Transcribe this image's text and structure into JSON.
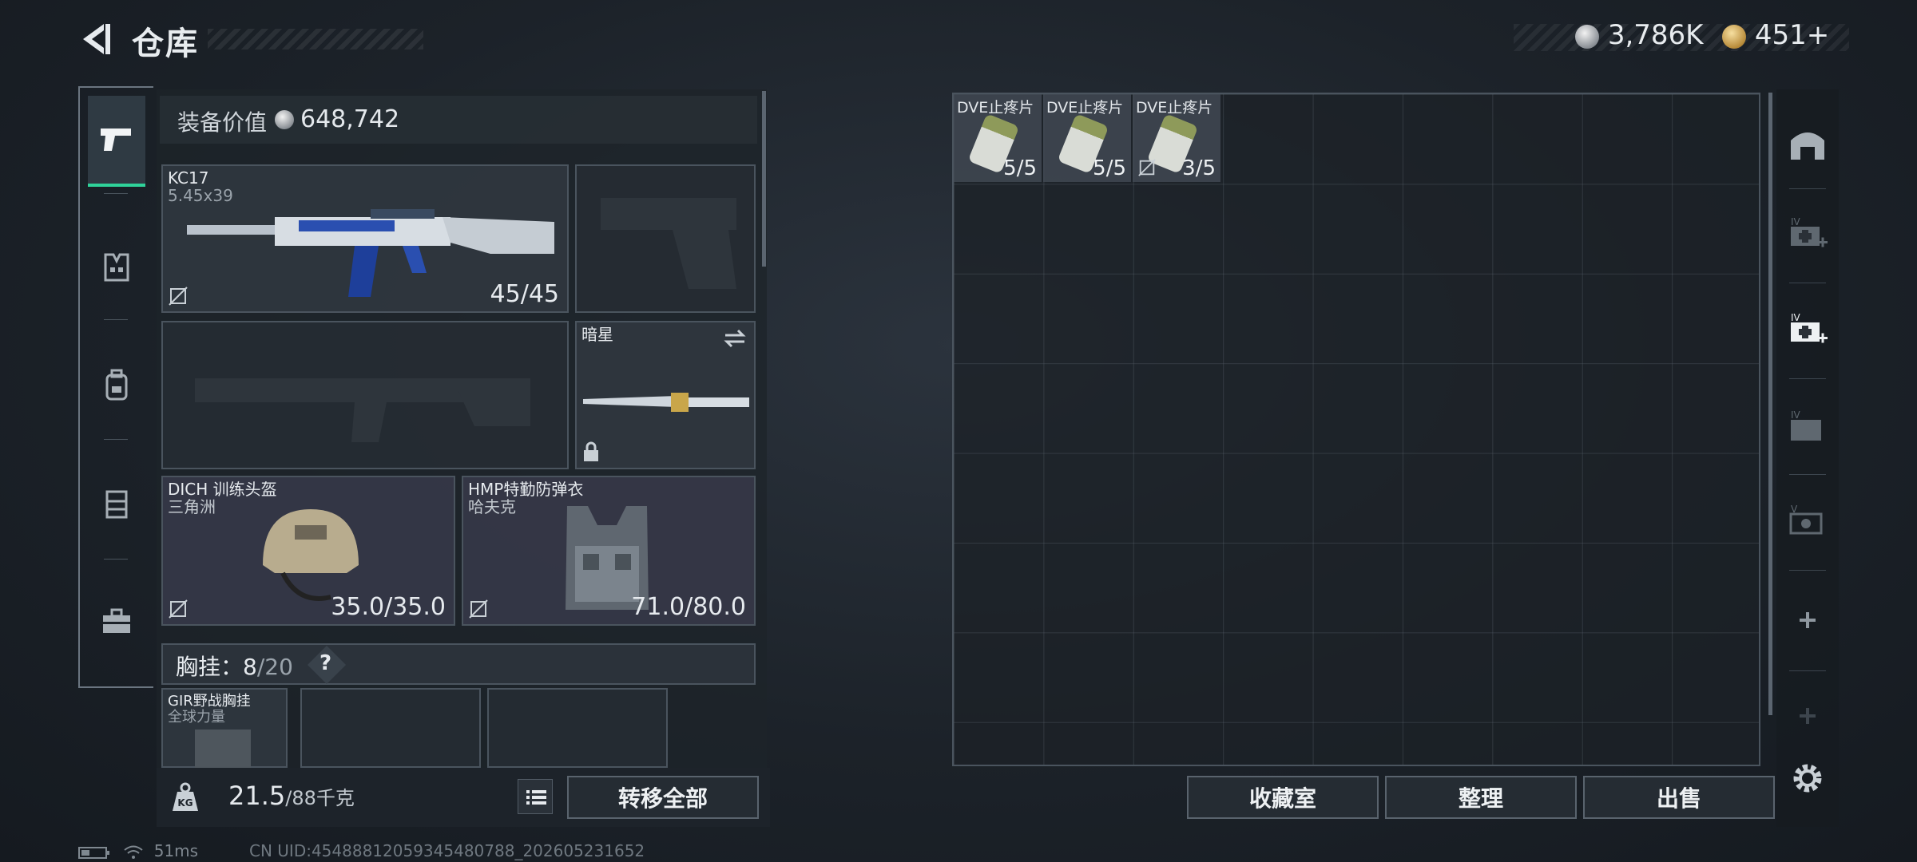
{
  "header": {
    "title": "仓库",
    "currency_silver": "3,786K",
    "currency_gold": "451+"
  },
  "nav": {
    "items": [
      "firearm",
      "armor-vest",
      "backpack",
      "rig",
      "toolbox"
    ],
    "active": "firearm"
  },
  "equipment": {
    "value_label": "装备价值",
    "value": "648,742",
    "primary": {
      "name": "KC17",
      "caliber": "5.45x39",
      "ammo": "45/45"
    },
    "melee": {
      "name": "暗星"
    },
    "helmet": {
      "name": "DICH 训练头盔",
      "origin": "三角洲",
      "durability": "35.0/35.0"
    },
    "armor": {
      "name": "HMP特勤防弹衣",
      "origin": "哈夫克",
      "durability": "71.0/80.0"
    },
    "rig": {
      "label": "胸挂：",
      "used": "8",
      "capacity": "/20",
      "help": "?"
    },
    "rig_item": {
      "name": "GIR野战胸挂",
      "origin": "全球力量"
    }
  },
  "footer_left": {
    "weight": "21.5",
    "weight_max": "/88千克",
    "kg_label": "KG",
    "transfer_all": "转移全部"
  },
  "stash": {
    "items": [
      {
        "name": "DVE止疼片",
        "count": "5/5",
        "no_insure": false
      },
      {
        "name": "DVE止疼片",
        "count": "5/5",
        "no_insure": false
      },
      {
        "name": "DVE止疼片",
        "count": "3/5",
        "no_insure": true
      }
    ],
    "buttons": {
      "collection": "收藏室",
      "organize": "整理",
      "sell": "出售"
    }
  },
  "status_bar": {
    "ping": "51ms",
    "uid": "CN UID:454888120593454807​88_202605231652"
  },
  "colors": {
    "accent": "#2fd39a",
    "panel": "#252c33"
  }
}
